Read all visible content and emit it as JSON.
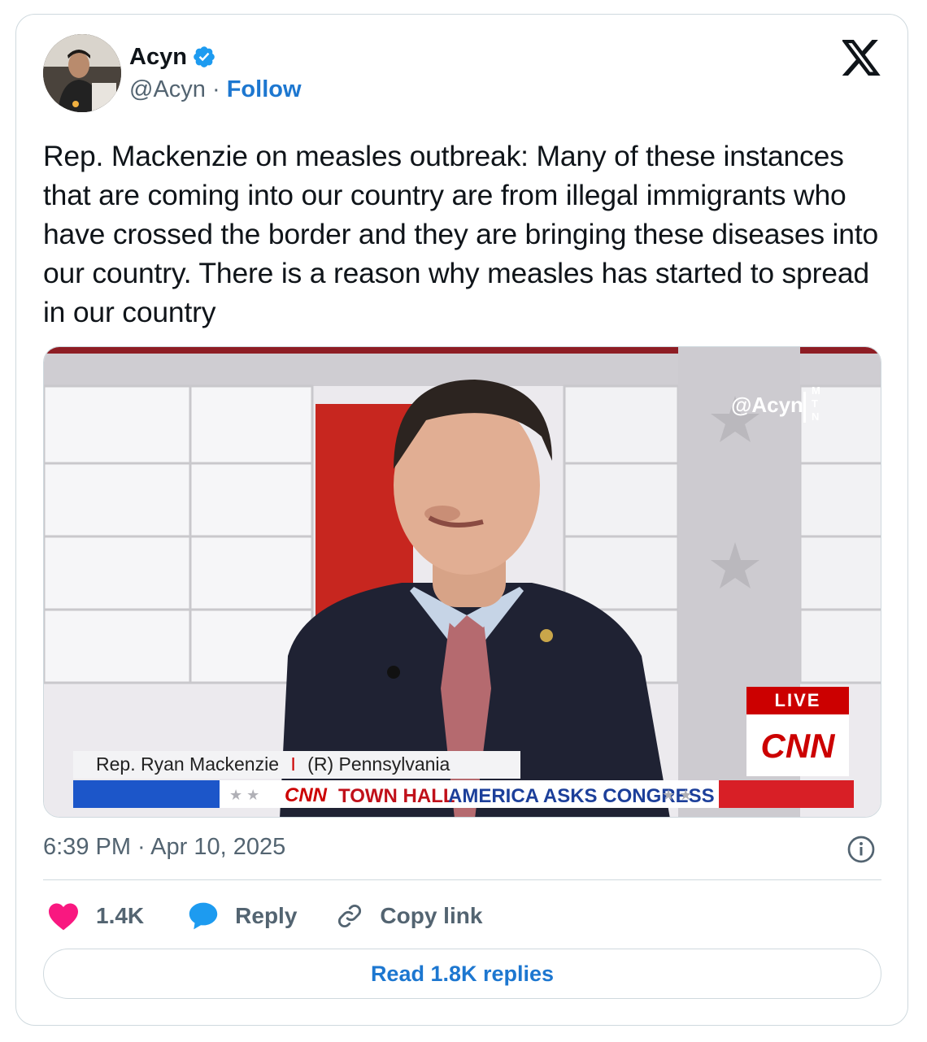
{
  "author": {
    "name": "Acyn",
    "handle": "@Acyn",
    "separator": " · ",
    "follow_label": "Follow"
  },
  "tweet": {
    "text": "Rep. Mackenzie on measles outbreak: Many of these instances that are coming into our country are from illegal immigrants who have crossed the border and they are bringing these diseases into our country. There is a reason why measles has started to spread in our country",
    "timestamp": "6:39 PM · Apr 10, 2025"
  },
  "media": {
    "watermark_handle": "@Acyn",
    "watermark_letters": [
      "M",
      "T",
      "N"
    ],
    "live_label": "LIVE",
    "network_logo": "CNN",
    "lower_third_name": "Rep. Ryan Mackenzie",
    "lower_third_separator": "I",
    "lower_third_party": "(R) Pennsylvania",
    "banner_network": "CNN",
    "banner_town_hall": "TOWN HALL",
    "banner_america": "AMERICA ASKS CONGRESS"
  },
  "actions": {
    "like_count": "1.4K",
    "reply_label": "Reply",
    "copy_label": "Copy link"
  },
  "read_replies_label": "Read 1.8K replies",
  "colors": {
    "accent_blue": "#1d77d0",
    "like_pink": "#f91880",
    "reply_blue": "#1d9bf0",
    "cnn_red": "#cc0000"
  },
  "icons": {
    "verified": "verified-badge-icon",
    "x_logo": "x-logo-icon",
    "info": "info-icon",
    "like": "heart-icon",
    "reply": "speech-bubble-icon",
    "copy": "link-icon"
  }
}
